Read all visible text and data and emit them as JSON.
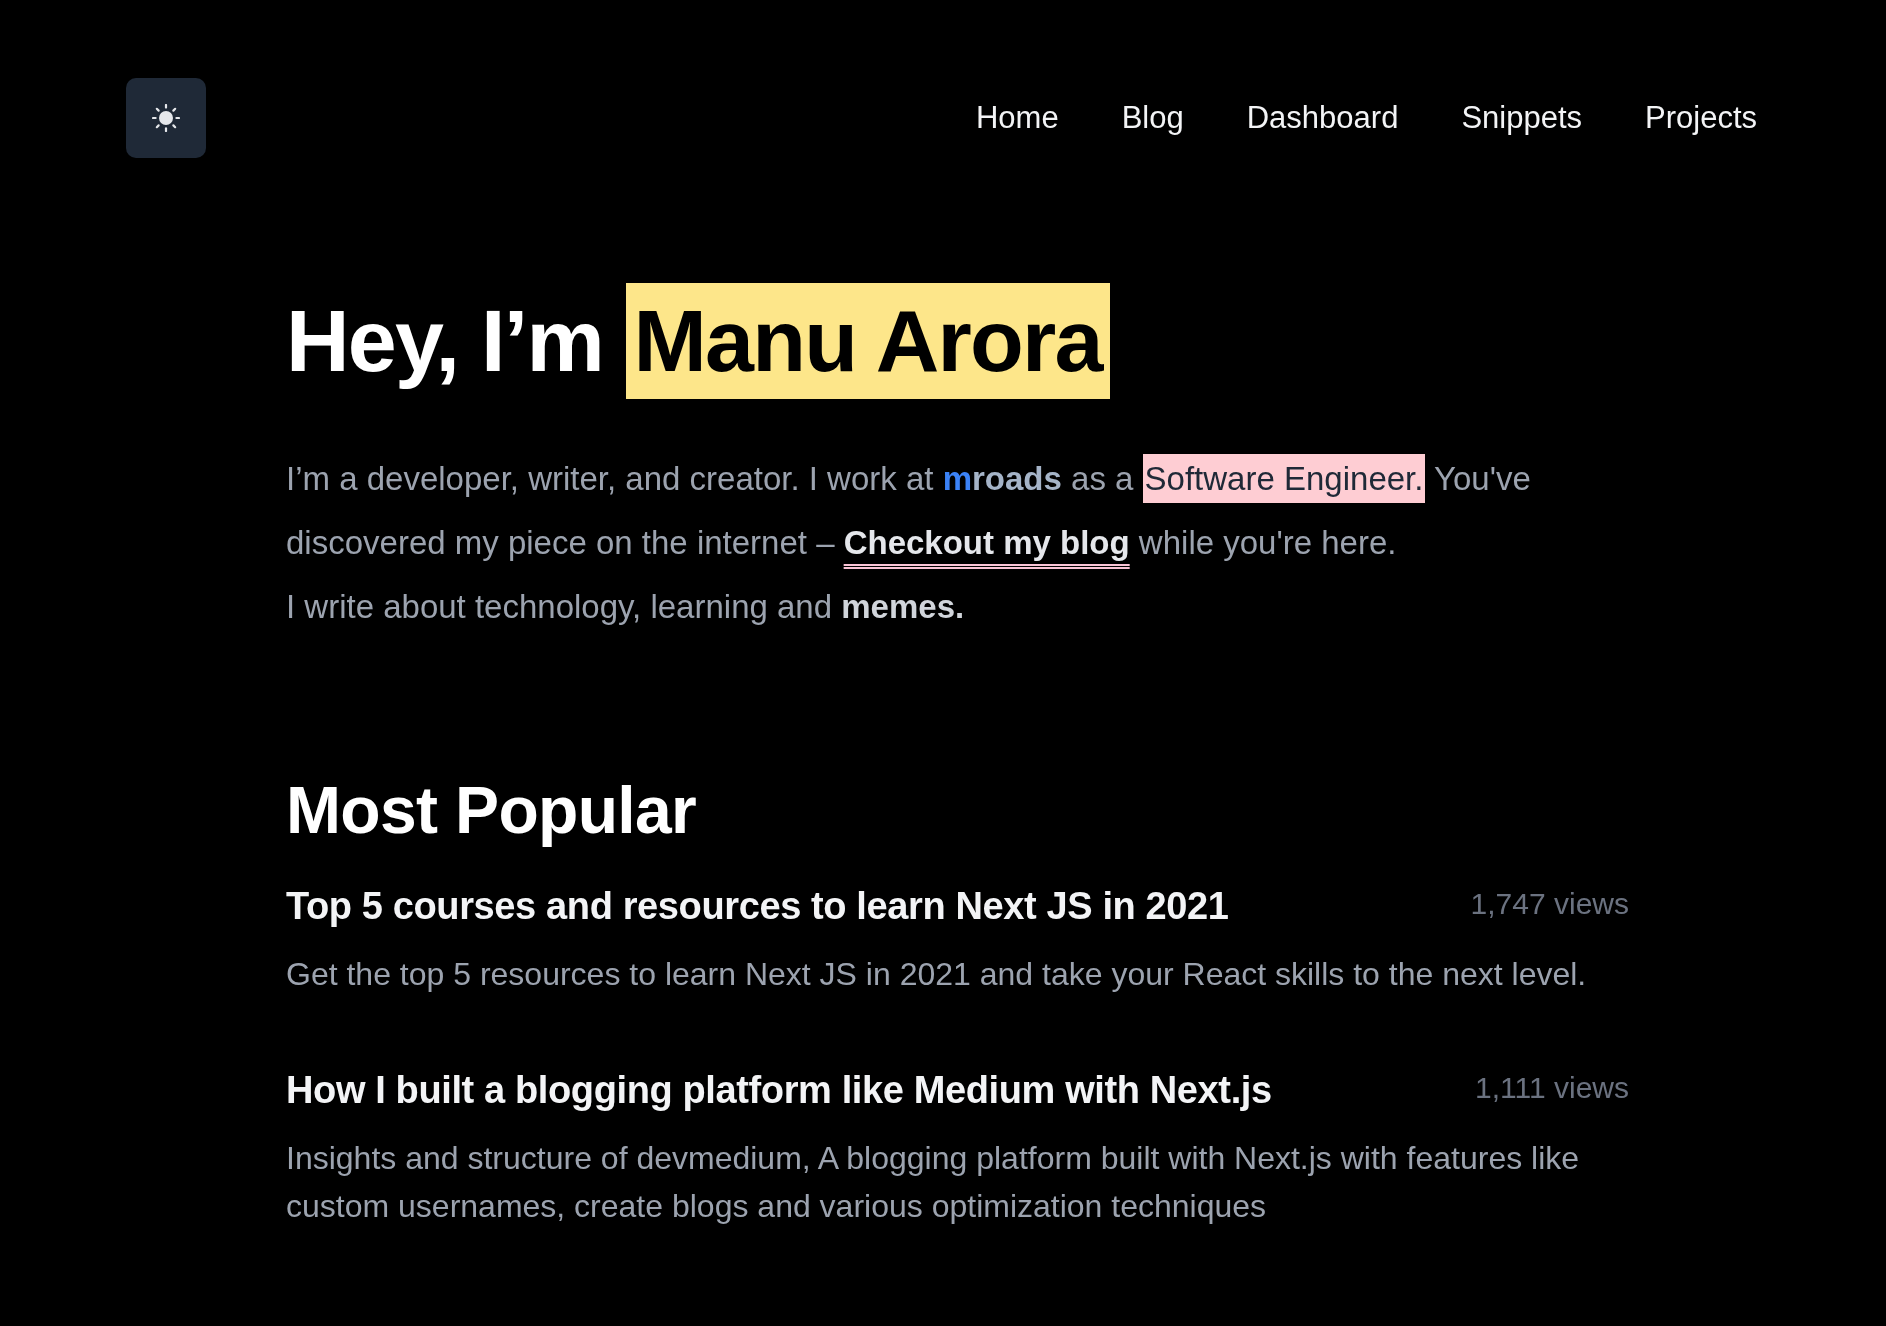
{
  "nav": {
    "items": [
      {
        "label": "Home"
      },
      {
        "label": "Blog"
      },
      {
        "label": "Dashboard"
      },
      {
        "label": "Snippets"
      },
      {
        "label": "Projects"
      }
    ]
  },
  "hero": {
    "greeting": "Hey, I’m",
    "name": "Manu Arora",
    "intro": [
      {
        "kind": "text",
        "text": "I’m a developer, writer, and creator. I work at"
      },
      {
        "kind": "company_link",
        "accent": "m",
        "rest": "roads"
      },
      {
        "kind": "text",
        "text": "as a"
      },
      {
        "kind": "highlight",
        "text": "Software Engineer."
      },
      {
        "kind": "text",
        "text": "You've discovered my piece on the internet –"
      },
      {
        "kind": "blog_link",
        "text": "Checkout my blog"
      },
      {
        "kind": "text",
        "text": "while you're here."
      }
    ],
    "interests": "I write about technology, learning and **memes.**"
  },
  "popular": {
    "title": "Most Popular",
    "posts": [
      {
        "title": "Top 5 courses and resources to learn Next JS in 2021",
        "views": "1,747 views",
        "summary": "Get the top 5 resources to learn Next JS in 2021 and take your React skills to the next level."
      },
      {
        "title": "How I built a blogging platform like Medium with Next.js",
        "views": "1,111 views",
        "summary": "Insights and structure of devmedium, A blogging platform built with Next.js with features like custom usernames, create blogs and various optimization techniques"
      }
    ]
  }
}
